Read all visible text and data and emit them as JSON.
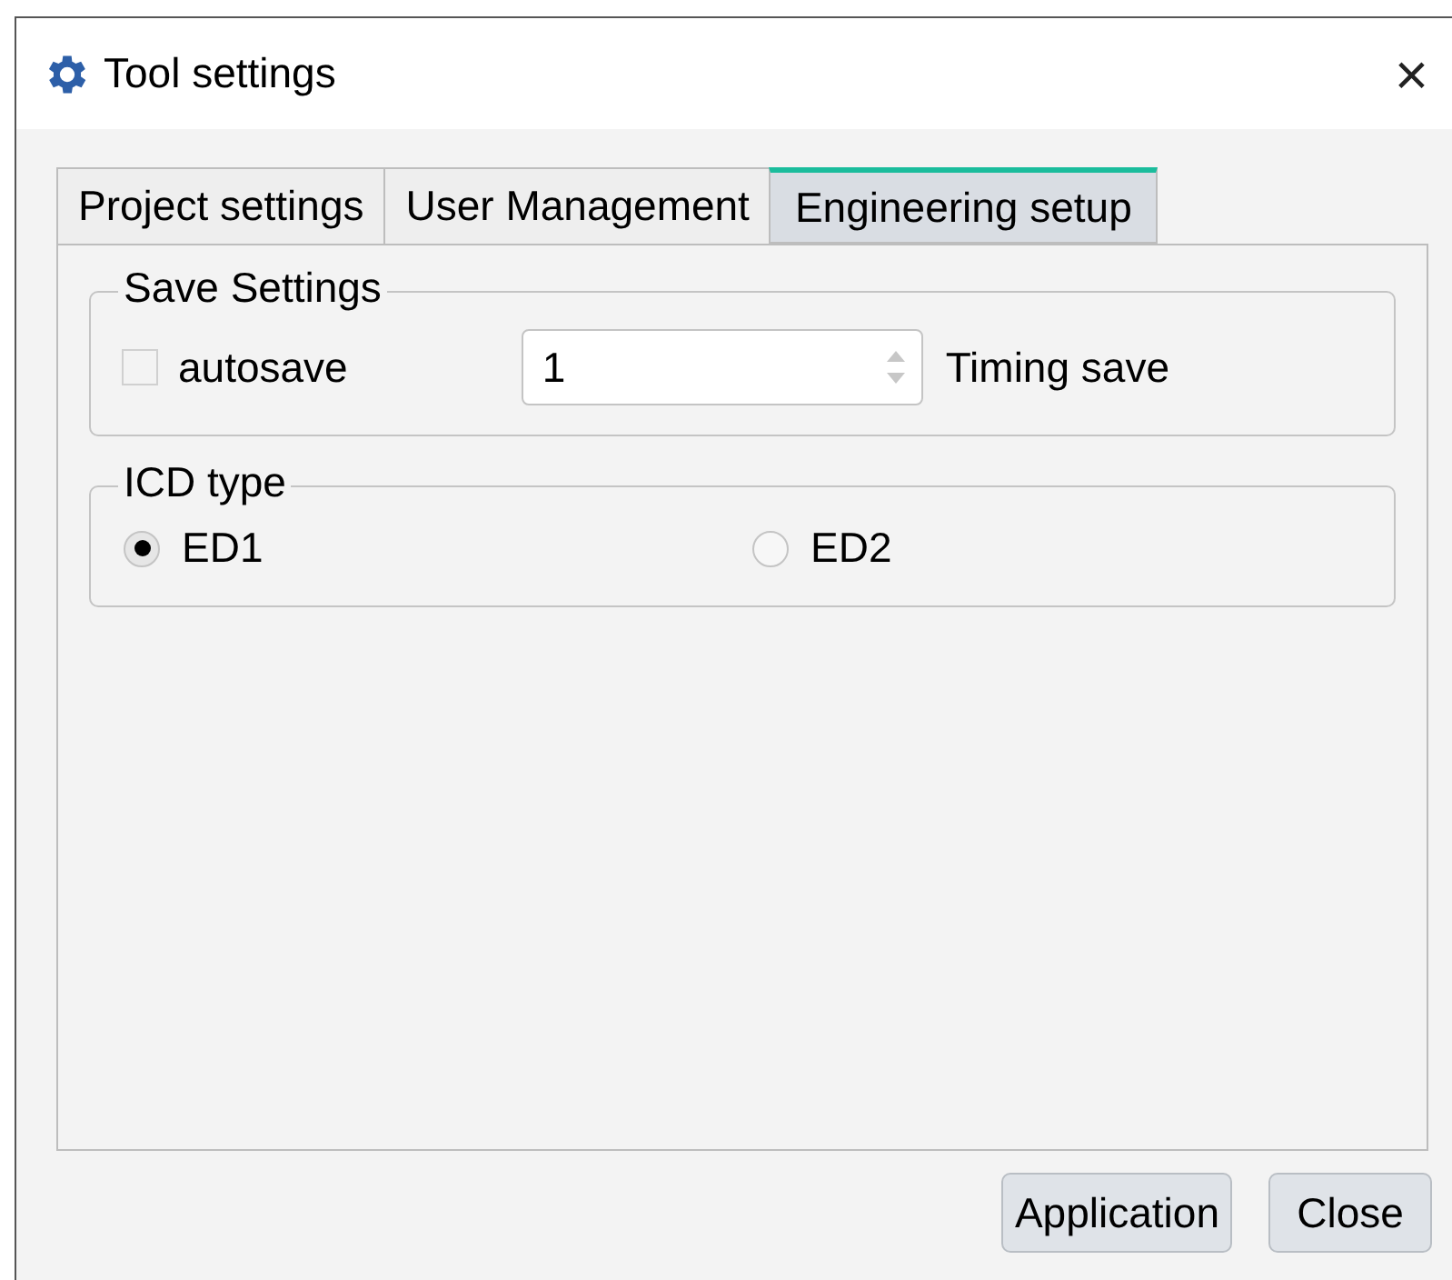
{
  "window": {
    "title": "Tool settings",
    "close": "×"
  },
  "tabs": [
    {
      "label": "Project settings",
      "selected": false
    },
    {
      "label": "User Management",
      "selected": false
    },
    {
      "label": "Engineering setup",
      "selected": true
    }
  ],
  "save_settings": {
    "title": "Save Settings",
    "autosave": {
      "label": "autosave",
      "checked": false
    },
    "interval": {
      "value": "1"
    },
    "interval_label": "Timing save"
  },
  "icd_type": {
    "title": "ICD type",
    "options": [
      {
        "label": "ED1",
        "selected": true
      },
      {
        "label": "ED2",
        "selected": false
      }
    ]
  },
  "buttons": [
    "Application",
    "Close"
  ]
}
